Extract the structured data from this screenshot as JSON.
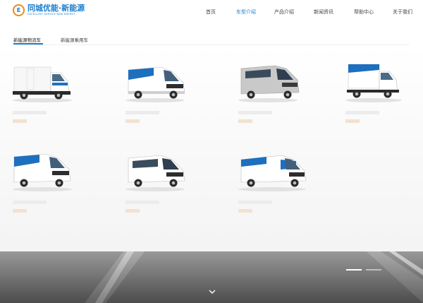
{
  "brand": {
    "title": "同城优能·新能源",
    "subtitle": "EXCELLENT SERVICE NEW ENERGY",
    "mark": "E",
    "colors": {
      "primary": "#1a7fcf",
      "accent": "#f08a1c"
    }
  },
  "nav": {
    "items": [
      {
        "label": "首页",
        "active": false
      },
      {
        "label": "车型介绍",
        "active": true
      },
      {
        "label": "产品介绍",
        "active": false
      },
      {
        "label": "新闻资讯",
        "active": false
      },
      {
        "label": "帮助中心",
        "active": false
      },
      {
        "label": "关于我们",
        "active": false
      }
    ]
  },
  "tabs": [
    {
      "label": "新能源物流车",
      "active": true
    },
    {
      "label": "新能源乘用车",
      "active": false
    }
  ],
  "products": [
    {
      "type": "box-truck",
      "color": "white-blue"
    },
    {
      "type": "van",
      "color": "white-blue"
    },
    {
      "type": "van",
      "color": "silver"
    },
    {
      "type": "box-truck-small",
      "color": "white-blue"
    },
    {
      "type": "van",
      "color": "white-blue"
    },
    {
      "type": "minivan",
      "color": "white"
    },
    {
      "type": "van-long",
      "color": "white-blue"
    }
  ],
  "banner": {
    "slides": 2,
    "active_slide": 0,
    "scroll_icon": "chevron-down-icon"
  }
}
